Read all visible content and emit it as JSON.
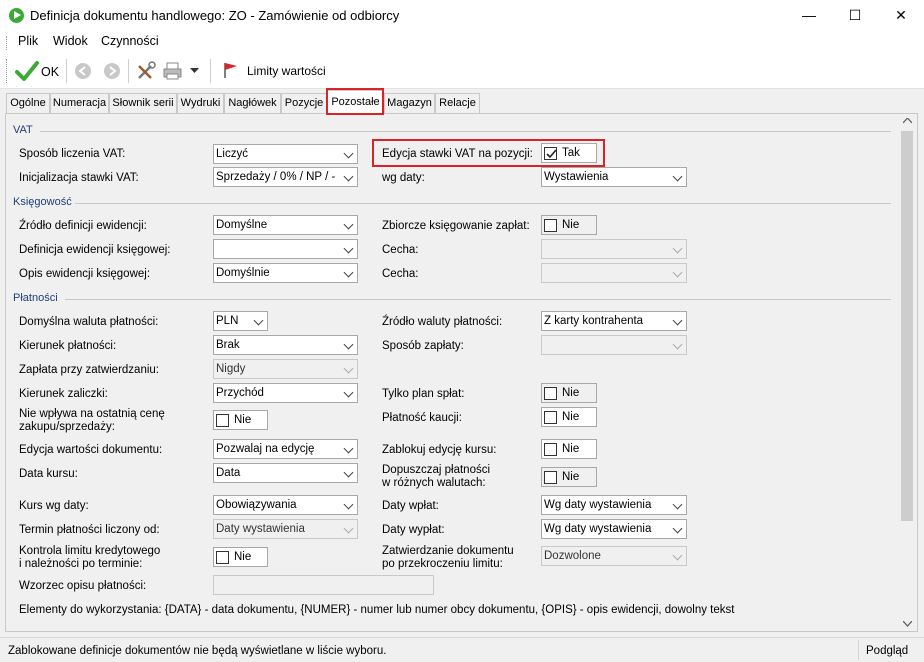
{
  "window": {
    "title": "Definicja dokumentu handlowego: ZO - Zamówienie od odbiorcy",
    "minimize": "—",
    "maximize": "☐",
    "close": "✕"
  },
  "menu": [
    "Plik",
    "Widok",
    "Czynności"
  ],
  "toolbar": {
    "ok_label": "OK",
    "limits_label": "Limity wartości"
  },
  "tabs": [
    "Ogólne",
    "Numeracja",
    "Słownik serii",
    "Wydruki",
    "Nagłówek",
    "Pozycje",
    "Pozostałe",
    "Magazyn",
    "Relacje"
  ],
  "active_tab": "Pozostałe",
  "sections": {
    "vat": "VAT",
    "ksiegowosc": "Księgowość",
    "platnosci": "Płatności"
  },
  "vat": {
    "sposob_label": "Sposób liczenia VAT:",
    "sposob_value": "Liczyć",
    "edycja_label": "Edycja stawki VAT na pozycji:",
    "edycja_value": "Tak",
    "inicjalizacja_label": "Inicjalizacja stawki VAT:",
    "inicjalizacja_value": "Sprzedaży / 0% / NP / -",
    "wg_daty_label": "wg daty:",
    "wg_daty_value": "Wystawienia"
  },
  "ksiegowosc": {
    "zrodlo_label": "Źródło definicji ewidencji:",
    "zrodlo_value": "Domyślne",
    "zbiorcze_label": "Zbiorcze księgowanie zapłat:",
    "zbiorcze_value": "Nie",
    "definicja_label": "Definicja ewidencji księgowej:",
    "definicja_value": "",
    "cecha1_label": "Cecha:",
    "cecha1_value": "",
    "opis_label": "Opis ewidencji księgowej:",
    "opis_value": "Domyślnie",
    "cecha2_label": "Cecha:",
    "cecha2_value": ""
  },
  "platnosci": {
    "waluta_label": "Domyślna waluta płatności:",
    "waluta_value": "PLN",
    "zrodlo_waluty_label": "Źródło waluty płatności:",
    "zrodlo_waluty_value": "Z karty kontrahenta",
    "kierunek_label": "Kierunek płatności:",
    "kierunek_value": "Brak",
    "sposob_label": "Sposób zapłaty:",
    "sposob_value": "",
    "zaplata_label": "Zapłata przy zatwierdzaniu:",
    "zaplata_value": "Nigdy",
    "kierunek_zal_label": "Kierunek zaliczki:",
    "kierunek_zal_value": "Przychód",
    "tylko_plan_label": "Tylko plan spłat:",
    "tylko_plan_value": "Nie",
    "nie_wplywa_label_1": "Nie wpływa na ostatnią cenę",
    "nie_wplywa_label_2": "zakupu/sprzedaży:",
    "nie_wplywa_value": "Nie",
    "platnosc_kaucji_label": "Płatność kaucji:",
    "platnosc_kaucji_value": "Nie",
    "edycja_wart_label": "Edycja wartości dokumentu:",
    "edycja_wart_value": "Pozwalaj na edycję",
    "zablokuj_label": "Zablokuj edycję kursu:",
    "zablokuj_value": "Nie",
    "data_kursu_label": "Data kursu:",
    "data_kursu_value": "Data",
    "dopuszczaj_label_1": "Dopuszczaj płatności",
    "dopuszczaj_label_2": "w różnych walutach:",
    "dopuszczaj_value": "Nie",
    "kurs_wg_label": "Kurs wg daty:",
    "kurs_wg_value": "Obowiązywania",
    "daty_wplat_label": "Daty wpłat:",
    "daty_wplat_value": "Wg daty wystawienia",
    "termin_label": "Termin płatności liczony od:",
    "termin_value": "Daty wystawienia",
    "daty_wyplat_label": "Daty wypłat:",
    "daty_wyplat_value": "Wg daty wystawienia",
    "kontrola_label_1": "Kontrola limitu kredytowego",
    "kontrola_label_2": "i należności po terminie:",
    "kontrola_value": "Nie",
    "zatwierdzanie_label_1": "Zatwierdzanie dokumentu",
    "zatwierdzanie_label_2": "po przekroczeniu limitu:",
    "zatwierdzanie_value": "Dozwolone",
    "wzorzec_label": "Wzorzec opisu płatności:",
    "elementy_text": "Elementy do wykorzystania: {DATA} - data dokumentu, {NUMER} - numer lub numer obcy dokumentu, {OPIS} - opis ewidencji, dowolny tekst"
  },
  "status": {
    "message": "Zablokowane definicje dokumentów nie będą wyświetlane w liście wyboru.",
    "mode": "Podgląd"
  }
}
